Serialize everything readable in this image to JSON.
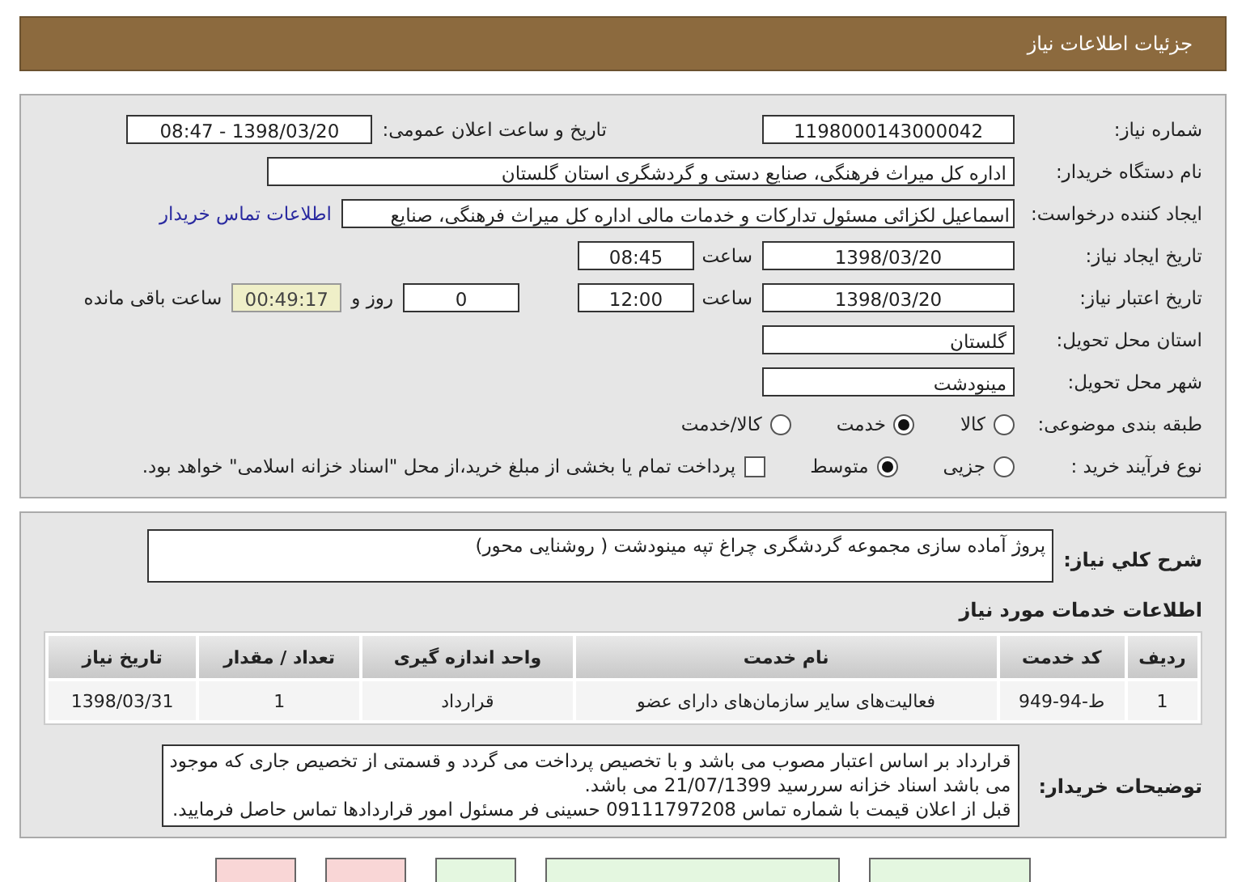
{
  "header": {
    "title": "جزئیات اطلاعات نیاز"
  },
  "details": {
    "need_number": {
      "label": "شماره نیاز:",
      "value": "1198000143000042"
    },
    "announce": {
      "label": "تاریخ و ساعت اعلان عمومی:",
      "value": "1398/03/20 - 08:47"
    },
    "buyer": {
      "label": "نام دستگاه خریدار:",
      "value": "اداره کل میراث فرهنگی، صنایع دستی و گردشگری استان گلستان"
    },
    "requester": {
      "label": "ایجاد کننده درخواست:",
      "value": "اسماعیل لکزائی مسئول تدارکات و خدمات مالی اداره کل میراث فرهنگی، صنایع",
      "link": "اطلاعات تماس خریدار"
    },
    "created": {
      "label": "تاریخ ایجاد نیاز:",
      "date": "1398/03/20",
      "time_label": "ساعت",
      "time": "08:45"
    },
    "validity": {
      "label": "تاریخ اعتبار نیاز:",
      "date": "1398/03/20",
      "time_label": "ساعت",
      "time": "12:00",
      "days": "0",
      "days_label": "روز و",
      "remaining": "00:49:17",
      "remaining_label": "ساعت باقی مانده"
    },
    "province": {
      "label": "استان محل تحویل:",
      "value": "گلستان"
    },
    "city": {
      "label": "شهر محل تحویل:",
      "value": "مینودشت"
    },
    "category": {
      "label": "طبقه بندی موضوعی:",
      "options": [
        {
          "label": "کالا",
          "selected": false
        },
        {
          "label": "خدمت",
          "selected": true
        },
        {
          "label": "کالا/خدمت",
          "selected": false
        }
      ]
    },
    "process": {
      "label": "نوع فرآیند خرید :",
      "options": [
        {
          "label": "جزیی",
          "selected": false
        },
        {
          "label": "متوسط",
          "selected": true
        }
      ],
      "payment": {
        "label": "پرداخت تمام یا بخشی از مبلغ خرید،از محل \"اسناد خزانه اسلامی\" خواهد بود.",
        "checked": false
      }
    }
  },
  "summary": {
    "label": "شرح کلي نياز:",
    "value": "پروژ آماده سازی مجموعه گردشگری چراغ تپه مینودشت ( روشنایی محور)"
  },
  "services": {
    "title": "اطلاعات خدمات مورد نیاز",
    "columns": [
      "ردیف",
      "کد خدمت",
      "نام خدمت",
      "واحد اندازه گیری",
      "تعداد / مقدار",
      "تاریخ نیاز"
    ],
    "rows": [
      [
        "1",
        "ط-94-949",
        "فعالیت‌های سایر سازمان‌های دارای عضو",
        "قرارداد",
        "1",
        "1398/03/31"
      ]
    ]
  },
  "buyer_notes": {
    "label": "توضیحات خریدار:",
    "paragraphs": [
      "قرارداد بر اساس اعتبار مصوب می باشد و با تخصیص پرداخت می گردد و قسمتی از تخصیص جاری که موجود می باشد اسناد خزانه سررسید 21/07/1399 می باشد.",
      "قبل از اعلان قیمت با شماره تماس 09111797208 حسینی فر مسئول امور قراردادها تماس حاصل فرمایید."
    ]
  },
  "buttons": [
    {
      "kind": "primary"
    },
    {
      "kind": "primary"
    },
    {
      "kind": "primary"
    },
    {
      "kind": "danger"
    },
    {
      "kind": "danger"
    }
  ]
}
